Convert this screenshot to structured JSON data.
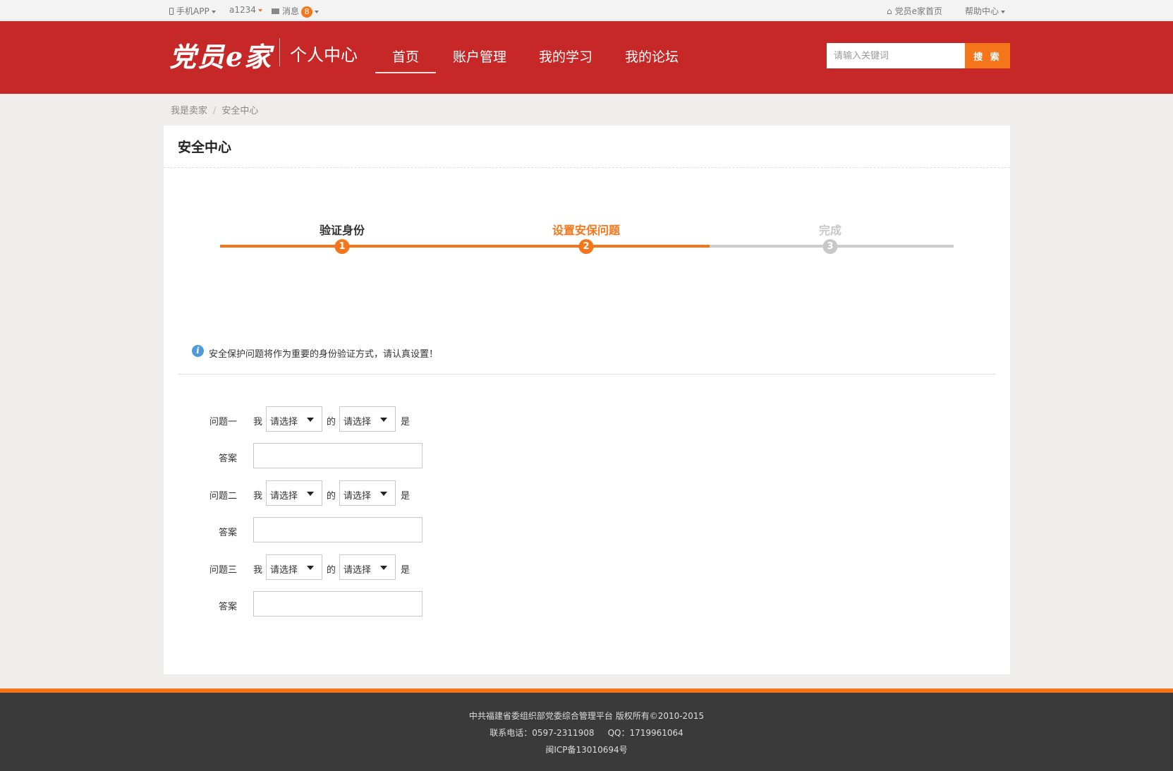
{
  "topbar": {
    "app_label": "手机APP",
    "username": "a1234",
    "messages_label": "消息",
    "messages_count": "8",
    "home_link": "党员e家首页",
    "help_label": "帮助中心"
  },
  "header": {
    "logo": "党员e家",
    "subtitle": "个人中心",
    "nav": [
      "首页",
      "账户管理",
      "我的学习",
      "我的论坛"
    ],
    "search_placeholder": "请输入关键词",
    "search_button": "搜 索"
  },
  "breadcrumb": [
    "我是卖家",
    "安全中心"
  ],
  "panel": {
    "title": "安全中心",
    "steps": [
      {
        "label": "验证身份",
        "number": "1",
        "state": "done"
      },
      {
        "label": "设置安保问题",
        "number": "2",
        "state": "current"
      },
      {
        "label": "完成",
        "number": "3",
        "state": "pending"
      }
    ],
    "progress": 0.667,
    "info_text": "安全保护问题将作为重要的身份验证方式，请认真设置！",
    "form": {
      "questions": [
        {
          "label": "问题一",
          "answer_label": "答案"
        },
        {
          "label": "问题二",
          "answer_label": "答案"
        },
        {
          "label": "问题三",
          "answer_label": "答案"
        }
      ],
      "word_me": "我",
      "word_of": "的",
      "word_is": "是",
      "select_placeholder": "请选择"
    }
  },
  "footer": {
    "line1": "中共福建省委组织部党委综合管理平台 版权所有©2010-2015",
    "line2": "联系电话：0597-2311908     QQ：1719961064",
    "line3": "闽ICP备13010694号"
  },
  "colors": {
    "brand_red": "#c62828",
    "accent_orange": "#f5761a",
    "pending_gray": "#cccccc",
    "footer_bg": "#3a3a3a"
  }
}
